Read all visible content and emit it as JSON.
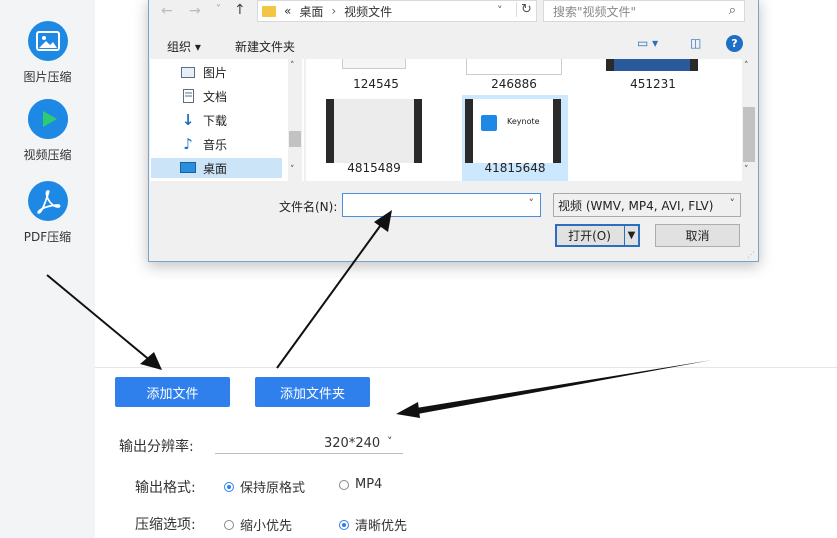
{
  "sidebar": {
    "items": [
      {
        "label": "图片压缩",
        "icon": "image-icon"
      },
      {
        "label": "视频压缩",
        "icon": "play-icon"
      },
      {
        "label": "PDF压缩",
        "icon": "pdf-icon"
      }
    ]
  },
  "actions": {
    "add_file": "添加文件",
    "add_folder": "添加文件夹"
  },
  "settings": {
    "resolution_label": "输出分辨率:",
    "resolution_value": "320*240",
    "format_label": "输出格式:",
    "format_options": [
      "保持原格式",
      "MP4"
    ],
    "format_selected": "保持原格式",
    "compress_label": "压缩选项:",
    "compress_options": [
      "缩小优先",
      "清晰优先"
    ],
    "compress_selected": "清晰优先"
  },
  "dialog": {
    "breadcrumb": [
      "«",
      "桌面",
      "视频文件"
    ],
    "search_placeholder": "搜索\"视频文件\"",
    "toolbar": {
      "organize": "组织",
      "new_folder": "新建文件夹"
    },
    "nav_items": [
      "图片",
      "文档",
      "下载",
      "音乐",
      "桌面"
    ],
    "files_top": [
      "124545",
      "246886",
      "451231"
    ],
    "files": [
      {
        "name": "4815489"
      },
      {
        "name": "41815648",
        "thumb_text": "Keynote"
      }
    ],
    "filename_label": "文件名(N):",
    "filename_value": "",
    "filter_value": "视频 (WMV, MP4, AVI, FLV)",
    "open_button": "打开(O)",
    "cancel_button": "取消"
  },
  "colors": {
    "accent": "#2f80ed",
    "sidebar_icon": "#1e88e5",
    "play_icon_green": "#2ecc71"
  }
}
